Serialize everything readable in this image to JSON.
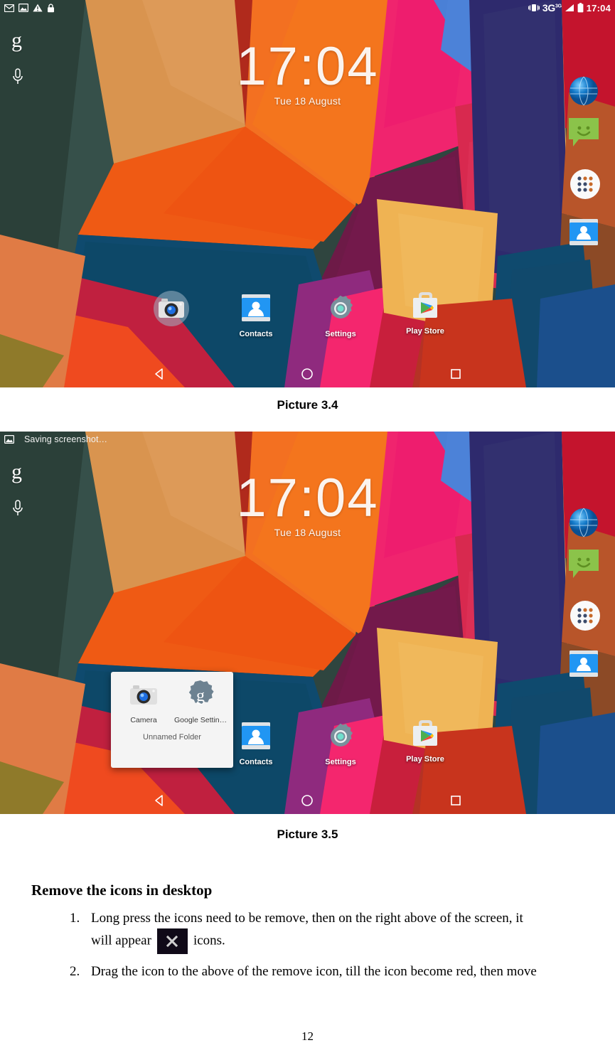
{
  "document": {
    "page_number": "12",
    "section_title": "Remove the icons in desktop",
    "steps": [
      {
        "num": "1.",
        "text_before": "Long  press  the  icons  need  to  be  remove,  then  on  the  right  above  of  the  screen,  it",
        "text_mid": "will appear",
        "icon": "close-x-icon",
        "text_after": "icons."
      },
      {
        "num": "2.",
        "text_before": "Drag the icon to the above of the remove icon, till the icon become red, then move",
        "text_mid": "",
        "icon": "",
        "text_after": ""
      }
    ]
  },
  "captions": {
    "picture_1": "Picture 3.4",
    "picture_2": "Picture 3.5"
  },
  "screenshot_1": {
    "statusbar": {
      "left_icons": [
        "email-icon",
        "screenshot-image-icon",
        "warning-triangle-icon",
        "lock-icon"
      ],
      "vibrate_icon": "vibrate-icon",
      "network_label": "3G",
      "network_sup": "3G",
      "signal_icon": "signal-bars-icon",
      "battery_icon": "battery-full-icon",
      "time": "17:04"
    },
    "google_widget": {
      "logo": "g",
      "mic_icon": "microphone-icon"
    },
    "clock_widget": {
      "time": "17:04",
      "date": "Tue 18 August"
    },
    "dock_apps": [
      {
        "label": "",
        "icon": "camera-icon"
      },
      {
        "label": "Contacts",
        "icon": "contacts-icon"
      },
      {
        "label": "Settings",
        "icon": "settings-gear-icon"
      },
      {
        "label": "Play Store",
        "icon": "play-store-icon"
      }
    ],
    "side_apps": [
      {
        "icon": "browser-globe-icon",
        "name": "Browser"
      },
      {
        "icon": "messaging-icon",
        "name": "Messaging"
      },
      {
        "icon": "app-drawer-icon",
        "name": "Apps"
      },
      {
        "icon": "contacts-icon",
        "name": "Contacts"
      }
    ],
    "navbar": [
      {
        "icon": "back-triangle-icon",
        "name": "Back"
      },
      {
        "icon": "home-circle-icon",
        "name": "Home"
      },
      {
        "icon": "recents-square-icon",
        "name": "Recents"
      }
    ]
  },
  "screenshot_2": {
    "statusbar": {
      "notification_icon": "screenshot-image-icon",
      "notification_text": "Saving screenshot…"
    },
    "google_widget": {
      "logo": "g",
      "mic_icon": "microphone-icon"
    },
    "clock_widget": {
      "time": "17:04",
      "date": "Tue 18 August"
    },
    "folder": {
      "name": "Unnamed Folder",
      "items": [
        {
          "label": "Camera",
          "icon": "camera-icon"
        },
        {
          "label": "Google Settin…",
          "icon": "google-settings-icon"
        }
      ]
    },
    "dock_apps": [
      {
        "label": "Contacts",
        "icon": "contacts-icon"
      },
      {
        "label": "Settings",
        "icon": "settings-gear-icon"
      },
      {
        "label": "Play Store",
        "icon": "play-store-icon"
      }
    ],
    "side_apps": [
      {
        "icon": "browser-globe-icon",
        "name": "Browser"
      },
      {
        "icon": "messaging-icon",
        "name": "Messaging"
      },
      {
        "icon": "app-drawer-icon",
        "name": "Apps"
      },
      {
        "icon": "contacts-icon",
        "name": "Contacts"
      }
    ],
    "navbar": [
      {
        "icon": "back-triangle-icon",
        "name": "Back"
      },
      {
        "icon": "home-circle-icon",
        "name": "Home"
      },
      {
        "icon": "recents-square-icon",
        "name": "Recents"
      }
    ]
  },
  "colors": {
    "wallpaper": [
      "#2f453f",
      "#d9904f",
      "#e8751a",
      "#f04e23",
      "#0f4a6e",
      "#c9234a",
      "#e8246e",
      "#f4436e",
      "#6b1745",
      "#8e2226",
      "#c1152b",
      "#efb353",
      "#4a7fd4",
      "#2e2a6b",
      "#b33a2a",
      "#8c3b1f"
    ],
    "accent_text": "#ffffff"
  }
}
